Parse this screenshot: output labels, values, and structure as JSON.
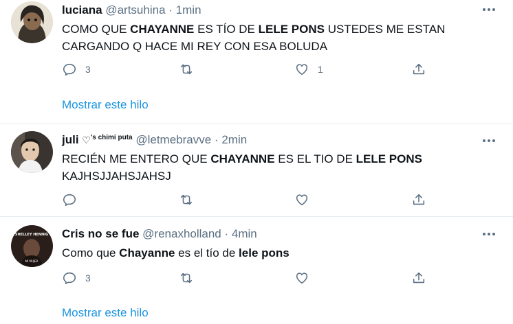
{
  "tweets": [
    {
      "name": "luciana",
      "handle": "@artsuhina",
      "sep": "·",
      "time": "1min",
      "text": [
        {
          "t": "COMO QUE ",
          "b": false
        },
        {
          "t": "CHAYANNE",
          "b": true
        },
        {
          "t": " ES TÍO DE ",
          "b": false
        },
        {
          "t": "LELE PONS",
          "b": true
        },
        {
          "t": " USTEDES ME ESTAN CARGANDO Q HACE MI REY CON ESA BOLUDA",
          "b": false
        }
      ],
      "reply_count": "3",
      "retweet_count": "",
      "like_count": "1",
      "show_thread": "Mostrar este hilo"
    },
    {
      "name": "juli",
      "name_heart": "♡",
      "name_sup": "'s chimi puta",
      "handle": "@letmebravve",
      "sep": "·",
      "time": "2min",
      "text": [
        {
          "t": "RECIÉN ME ENTERO QUE ",
          "b": false
        },
        {
          "t": "CHAYANNE",
          "b": true
        },
        {
          "t": " ES EL TIO DE ",
          "b": false
        },
        {
          "t": "LELE PONS",
          "b": true
        },
        {
          "t": " KAJHSJJAHSJAHSJ",
          "b": false
        }
      ],
      "reply_count": "",
      "retweet_count": "",
      "like_count": ""
    },
    {
      "name": "Cris no se fue",
      "handle": "@renaxholland",
      "sep": "·",
      "time": "4min",
      "avatar_text_top": "SHELLEY HENNIG",
      "avatar_text_bottom": "MI MUJER",
      "text": [
        {
          "t": "Como que ",
          "b": false
        },
        {
          "t": "Chayanne",
          "b": true
        },
        {
          "t": " es el tío de ",
          "b": false
        },
        {
          "t": "lele pons",
          "b": true
        }
      ],
      "reply_count": "3",
      "retweet_count": "",
      "like_count": "",
      "show_thread": "Mostrar este hilo"
    }
  ],
  "icons": {
    "reply": "reply-icon",
    "retweet": "retweet-icon",
    "like": "heart-icon",
    "share": "share-icon",
    "more": "more-icon"
  },
  "colors": {
    "text": "#0f1419",
    "meta": "#5b7083",
    "link": "#1b95e0",
    "divider": "#e6ecf0"
  }
}
